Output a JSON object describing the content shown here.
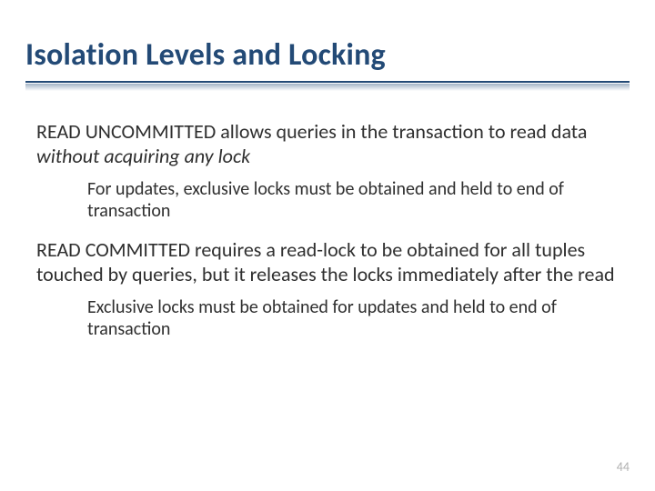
{
  "title": "Isolation Levels and Locking",
  "p1_a": "READ UNCOMMITTED allows queries in the transaction to read data ",
  "p1_b_italic": "without acquiring any lock",
  "sub1": "For updates, exclusive locks must be obtained and held to end of transaction",
  "p2": "READ COMMITTED requires a read-lock to be obtained for all tuples touched by queries, but it releases the locks immediately after the read",
  "sub2": "Exclusive locks must be obtained for updates and held to end of transaction",
  "page_number": "44"
}
